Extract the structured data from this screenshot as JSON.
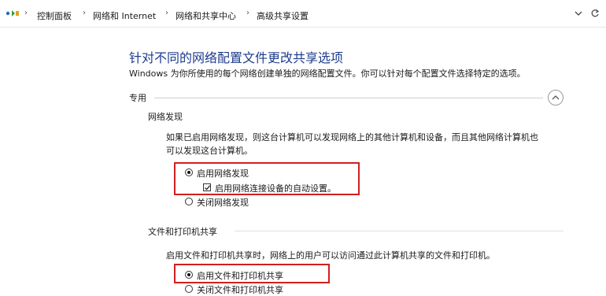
{
  "address_bar": {
    "crumbs": [
      "控制面板",
      "网络和 Internet",
      "网络和共享中心",
      "高级共享设置"
    ]
  },
  "page": {
    "title": "针对不同的网络配置文件更改共享选项",
    "description": "Windows 为你所使用的每个网络创建单独的网络配置文件。你可以针对每个配置文件选择特定的选项。"
  },
  "profile": {
    "label": "专用",
    "expanded": true
  },
  "network_discovery": {
    "heading": "网络发现",
    "description_line1": "如果已启用网络发现，则这台计算机可以发现网络上的其他计算机和设备，而且其他网络计算机也",
    "description_line2": "可以发现这台计算机。",
    "on_label": "启用网络发现",
    "auto_setup_label": "启用网络连接设备的自动设置。",
    "off_label": "关闭网络发现",
    "selected": "on",
    "auto_setup_checked": true
  },
  "file_printer_sharing": {
    "heading": "文件和打印机共享",
    "description": "启用文件和打印机共享时，网络上的用户可以访问通过此计算机共享的文件和打印机。",
    "on_label": "启用文件和打印机共享",
    "off_label": "关闭文件和打印机共享",
    "selected": "on"
  },
  "colors": {
    "title": "#1e3c8c",
    "highlight": "#d11f1f",
    "divider": "#cfcfcf"
  }
}
